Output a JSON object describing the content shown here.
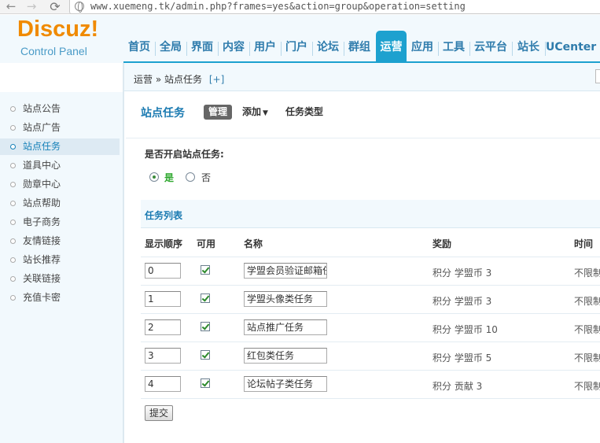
{
  "browser": {
    "url": "www.xuemeng.tk/admin.php?frames=yes&action=group&operation=setting",
    "back_icon": "arrow-left-icon",
    "forward_icon": "arrow-right-icon",
    "reload_icon": "reload-icon"
  },
  "logo": {
    "title": "Discuz!",
    "subtitle": "Control Panel"
  },
  "topnav": [
    {
      "label": "首页"
    },
    {
      "label": "全局"
    },
    {
      "label": "界面"
    },
    {
      "label": "内容"
    },
    {
      "label": "用户"
    },
    {
      "label": "门户"
    },
    {
      "label": "论坛"
    },
    {
      "label": "群组"
    },
    {
      "label": "运营",
      "active": true
    },
    {
      "label": "应用"
    },
    {
      "label": "工具"
    },
    {
      "label": "云平台"
    },
    {
      "label": "站长"
    },
    {
      "label": "UCenter"
    }
  ],
  "breadcrumb": {
    "parent": "运营",
    "separator": "»",
    "current": "站点任务",
    "add_link": "[+]"
  },
  "sidebar": {
    "items": [
      {
        "label": "站点公告"
      },
      {
        "label": "站点广告"
      },
      {
        "label": "站点任务",
        "active": true
      },
      {
        "label": "道具中心"
      },
      {
        "label": "勋章中心"
      },
      {
        "label": "站点帮助"
      },
      {
        "label": "电子商务"
      },
      {
        "label": "友情链接"
      },
      {
        "label": "站长推荐"
      },
      {
        "label": "关联链接"
      },
      {
        "label": "充值卡密"
      }
    ]
  },
  "main": {
    "title": "站点任务",
    "tabs": {
      "manage": "管理",
      "add": "添加",
      "types": "任务类型"
    },
    "enable_question": "是否开启站点任务:",
    "radio_yes": "是",
    "radio_no": "否",
    "radio_selected": "是",
    "list_title": "任务列表",
    "columns": {
      "order": "显示顺序",
      "enabled": "可用",
      "name": "名称",
      "reward": "奖励",
      "time": "时间"
    },
    "rows": [
      {
        "order": "0",
        "enabled": true,
        "name": "学盟会员验证邮箱任务",
        "reward": "积分 学盟币 3",
        "time": "不限制"
      },
      {
        "order": "1",
        "enabled": true,
        "name": "学盟头像类任务",
        "reward": "积分 学盟币 3",
        "time": "不限制"
      },
      {
        "order": "2",
        "enabled": true,
        "name": "站点推广任务",
        "reward": "积分 学盟币 10",
        "time": "不限制"
      },
      {
        "order": "3",
        "enabled": true,
        "name": "红包类任务",
        "reward": "积分 学盟币 5",
        "time": "不限制"
      },
      {
        "order": "4",
        "enabled": true,
        "name": "论坛帖子类任务",
        "reward": "积分 贡献 3",
        "time": "不限制"
      }
    ],
    "submit_label": "提交"
  },
  "colors": {
    "accent": "#1da1cf",
    "brand_orange": "#f08a00",
    "link_blue": "#1a7ab1",
    "panel_bg": "#f2f9fd"
  }
}
